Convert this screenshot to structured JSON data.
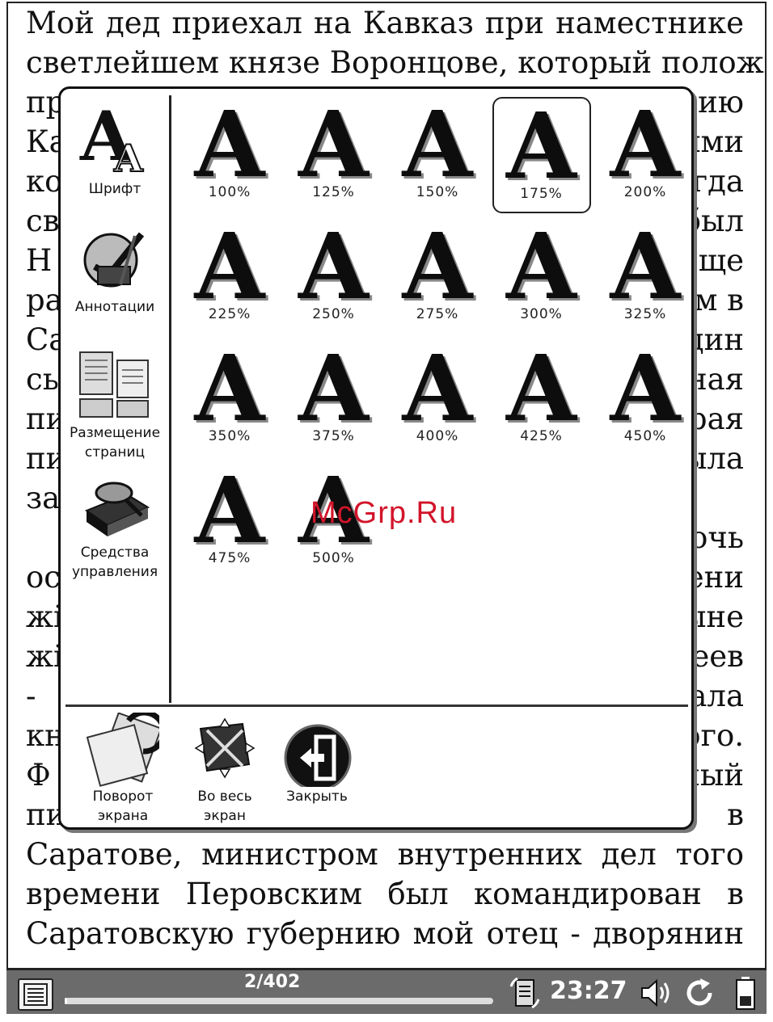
{
  "book_text": {
    "lines_top": [
      "Мой дед приехал на Кавказ при наместнике",
      "светлейшем князе Воронцове, который положил"
    ],
    "right_fragments": [
      "нию",
      "ыми",
      "огда",
      "был",
      "еще",
      "ом в",
      "один",
      "ная",
      "рая",
      "ыла",
      "очь",
      "ени",
      "ыне",
      "еев",
      "ала",
      "ого.",
      "ный",
      "в"
    ],
    "left_fragments": [
      "пр",
      "Ка",
      "ко",
      "св",
      "Н",
      "ра",
      "Са",
      "сь",
      "пи",
      "пи",
      "за",
      "",
      "ос",
      "жі",
      "жі",
      "-",
      "кн",
      "Ф",
      "пи"
    ],
    "lines_bottom": [
      "Саратове, министром внутренних дел того",
      "времени Перовским был командирован в",
      "Саратовскую губернию мой отец - дворянин"
    ]
  },
  "popup": {
    "sidebar": [
      {
        "label": "Шрифт"
      },
      {
        "label": "Аннотации"
      },
      {
        "label": "Размещение страниц"
      },
      {
        "label": "Средства управления"
      }
    ],
    "font_sizes": [
      "100%",
      "125%",
      "150%",
      "175%",
      "200%",
      "225%",
      "250%",
      "275%",
      "300%",
      "325%",
      "350%",
      "375%",
      "400%",
      "425%",
      "450%",
      "475%",
      "500%"
    ],
    "selected_size": "175%",
    "glyph": "A",
    "bottom": [
      {
        "label": "Поворот экрана"
      },
      {
        "label": "Во весь экран"
      },
      {
        "label": "Закрыть"
      }
    ]
  },
  "watermark": "McGrp.Ru",
  "status": {
    "page": "2/402",
    "progress": 0.005,
    "time": "23:27"
  }
}
